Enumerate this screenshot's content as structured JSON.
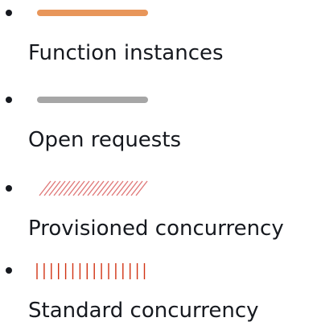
{
  "chart_data": {
    "type": "legend",
    "legend": [
      {
        "label": "Function instances",
        "style": "solid-line",
        "color": "#e8965a"
      },
      {
        "label": "Open requests",
        "style": "solid-line",
        "color": "#a6a6a6"
      },
      {
        "label": "Provisioned concurrency",
        "style": "diagonal-hatch",
        "color": "#e07a7a"
      },
      {
        "label": "Standard concurrency",
        "style": "vertical-hatch",
        "color": "#d13212"
      }
    ]
  }
}
